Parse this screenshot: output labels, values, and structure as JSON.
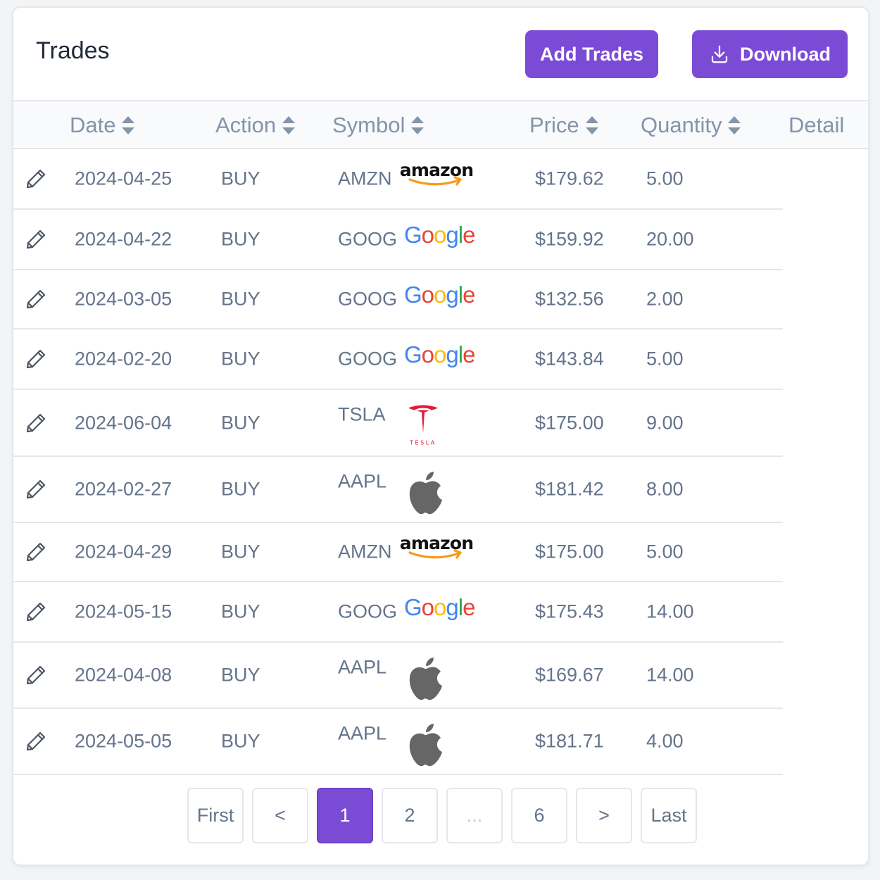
{
  "card": {
    "title": "Trades",
    "add_label": "Add Trades",
    "download_label": "Download"
  },
  "columns": {
    "date": "Date",
    "action": "Action",
    "symbol": "Symbol",
    "price": "Price",
    "quantity": "Quantity",
    "detail": "Detail"
  },
  "rows": [
    {
      "date": "2024-04-25",
      "action": "BUY",
      "symbol": "AMZN",
      "logo": "amazon-logo",
      "price": "$179.62",
      "quantity": "5.00"
    },
    {
      "date": "2024-04-22",
      "action": "BUY",
      "symbol": "GOOG",
      "logo": "google-logo",
      "price": "$159.92",
      "quantity": "20.00"
    },
    {
      "date": "2024-03-05",
      "action": "BUY",
      "symbol": "GOOG",
      "logo": "google-logo",
      "price": "$132.56",
      "quantity": "2.00"
    },
    {
      "date": "2024-02-20",
      "action": "BUY",
      "symbol": "GOOG",
      "logo": "google-logo",
      "price": "$143.84",
      "quantity": "5.00"
    },
    {
      "date": "2024-06-04",
      "action": "BUY",
      "symbol": "TSLA",
      "logo": "tesla-logo",
      "price": "$175.00",
      "quantity": "9.00"
    },
    {
      "date": "2024-02-27",
      "action": "BUY",
      "symbol": "AAPL",
      "logo": "apple-logo",
      "price": "$181.42",
      "quantity": "8.00"
    },
    {
      "date": "2024-04-29",
      "action": "BUY",
      "symbol": "AMZN",
      "logo": "amazon-logo",
      "price": "$175.00",
      "quantity": "5.00"
    },
    {
      "date": "2024-05-15",
      "action": "BUY",
      "symbol": "GOOG",
      "logo": "google-logo",
      "price": "$175.43",
      "quantity": "14.00"
    },
    {
      "date": "2024-04-08",
      "action": "BUY",
      "symbol": "AAPL",
      "logo": "apple-logo",
      "price": "$169.67",
      "quantity": "14.00"
    },
    {
      "date": "2024-05-05",
      "action": "BUY",
      "symbol": "AAPL",
      "logo": "apple-logo",
      "price": "$181.71",
      "quantity": "4.00"
    }
  ],
  "pagination": {
    "first": "First",
    "prev": "<",
    "pages": [
      "1",
      "2",
      "...",
      "6"
    ],
    "current": "1",
    "next": ">",
    "last": "Last"
  },
  "colors": {
    "accent": "#7b4bd6",
    "header_bg": "#f8fafc",
    "border": "#e5e7eb"
  },
  "icons": {
    "edit": "pencil-icon",
    "sort": "sort-icon",
    "download": "download-icon"
  }
}
